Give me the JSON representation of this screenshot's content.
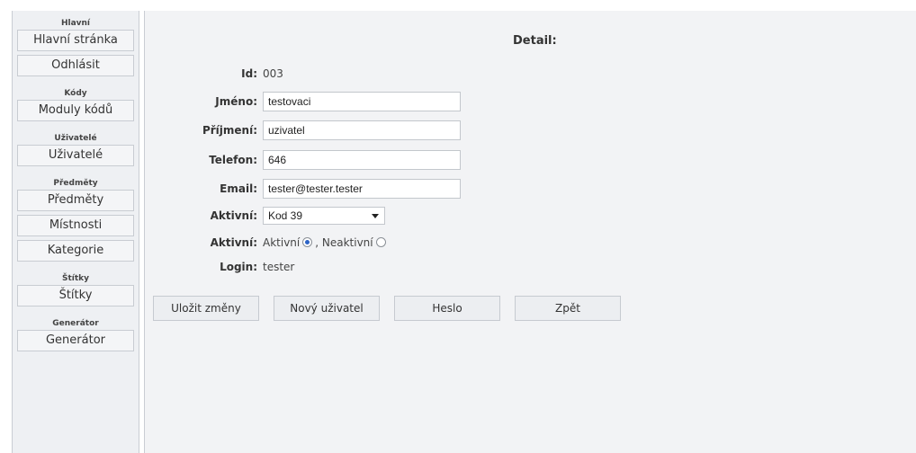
{
  "sidebar": {
    "sections": [
      {
        "title": "Hlavní",
        "items": [
          "Hlavní stránka",
          "Odhlásit"
        ]
      },
      {
        "title": "Kódy",
        "items": [
          "Moduly kódů"
        ]
      },
      {
        "title": "Uživatelé",
        "items": [
          "Uživatelé"
        ]
      },
      {
        "title": "Předměty",
        "items": [
          "Předměty",
          "Místnosti",
          "Kategorie"
        ]
      },
      {
        "title": "Štítky",
        "items": [
          "Štítky"
        ]
      },
      {
        "title": "Generátor",
        "items": [
          "Generátor"
        ]
      }
    ]
  },
  "detail": {
    "title": "Detail:",
    "id_label": "Id:",
    "id_value": "003",
    "jmeno_label": "Jméno:",
    "jmeno_value": "testovaci",
    "prijmeni_label": "Příjmení:",
    "prijmeni_value": "uzivatel",
    "telefon_label": "Telefon:",
    "telefon_value": "646",
    "email_label": "Email:",
    "email_value": "tester@tester.tester",
    "select_label": "Aktivní:",
    "select_value": "Kod 39",
    "radio_label": "Aktivní:",
    "radio_option1": "Aktivní",
    "radio_sep": ", Neaktivní",
    "radio_selected": "Aktivní",
    "login_label": "Login:",
    "login_value": "tester"
  },
  "actions": {
    "save": "Uložit změny",
    "new_user": "Nový uživatel",
    "password": "Heslo",
    "back": "Zpět"
  }
}
